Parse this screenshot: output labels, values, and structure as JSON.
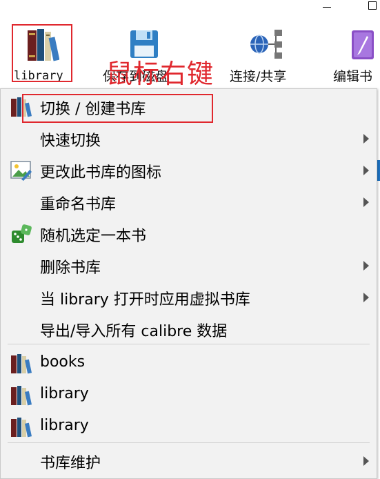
{
  "window_controls": {
    "minimize": "minimize",
    "maximize": "maximize"
  },
  "toolbar": {
    "library_label": "library",
    "save_label": "保存到磁盘",
    "connect_label": "连接/共享",
    "edit_label": "编辑书"
  },
  "annotation": {
    "text": "鼠标右键",
    "color": "#e0282e"
  },
  "menu": {
    "items": [
      {
        "label": "切换 / 创建书库",
        "icon": "library-books-icon",
        "submenu": false
      },
      {
        "label": "快速切换",
        "icon": "",
        "submenu": true
      },
      {
        "label": "更改此书库的图标",
        "icon": "change-icon-image-icon",
        "submenu": true
      },
      {
        "label": "重命名书库",
        "icon": "",
        "submenu": true
      },
      {
        "label": "随机选定一本书",
        "icon": "dice-icon",
        "submenu": false
      },
      {
        "label": "删除书库",
        "icon": "",
        "submenu": true
      },
      {
        "label": "当 library 打开时应用虚拟书库",
        "icon": "",
        "submenu": true
      },
      {
        "label": "导出/导入所有 calibre 数据",
        "icon": "",
        "submenu": false
      }
    ],
    "libraries": [
      {
        "label": "books",
        "icon": "library-books-icon"
      },
      {
        "label": "library",
        "icon": "library-books-icon"
      },
      {
        "label": "library",
        "icon": "library-books-icon"
      }
    ],
    "maintenance": {
      "label": "书库维护",
      "submenu": true
    }
  },
  "colors": {
    "highlight_red": "#e0282e",
    "menu_bg": "#f2f2f2",
    "accent_blue": "#1e74c4"
  }
}
